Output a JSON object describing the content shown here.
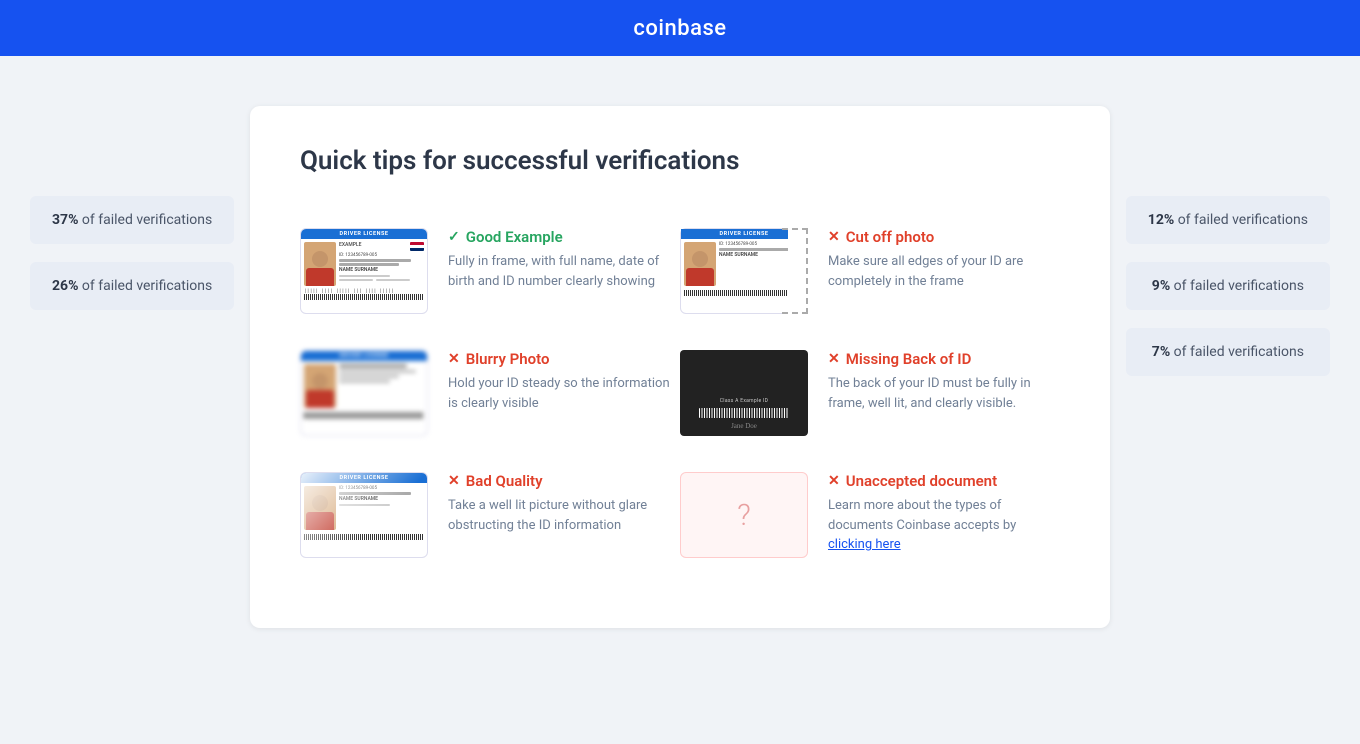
{
  "header": {
    "logo": "coinbase"
  },
  "page": {
    "title": "Quick tips for successful verifications"
  },
  "side_badges_left": [
    {
      "percent": "37%",
      "label": "of failed verifications"
    },
    {
      "percent": "26%",
      "label": "of failed verifications"
    }
  ],
  "side_badges_right": [
    {
      "percent": "12%",
      "label": "of failed verifications"
    },
    {
      "percent": "9%",
      "label": "of failed verifications"
    },
    {
      "percent": "7%",
      "label": "of failed verifications"
    }
  ],
  "tips": [
    {
      "id": "good-example",
      "type": "good",
      "title": "Good Example",
      "desc": "Fully in frame, with full name, date of birth and ID number clearly showing",
      "link": null
    },
    {
      "id": "cut-off-photo",
      "type": "bad",
      "title": "Cut off photo",
      "desc": "Make sure all edges of your ID are completely in the frame",
      "link": null
    },
    {
      "id": "blurry-photo",
      "type": "bad",
      "title": "Blurry Photo",
      "desc": "Hold your ID steady so the information is clearly visible",
      "link": null
    },
    {
      "id": "missing-back-of-id",
      "type": "bad",
      "title": "Missing Back of ID",
      "desc": "The back of your ID must be fully in frame, well lit, and clearly visible.",
      "link": null
    },
    {
      "id": "bad-quality",
      "type": "bad",
      "title": "Bad Quality",
      "desc": "Take a well lit picture without glare obstructing the ID information",
      "link": null
    },
    {
      "id": "unaccepted-document",
      "type": "bad",
      "title": "Unaccepted document",
      "desc": "Learn more about the types of documents Coinbase accepts by ",
      "link_text": "clicking here",
      "link": "#"
    }
  ],
  "id_card_labels": {
    "driver_license": "DRIVER LICENSE",
    "example": "EXAMPLE",
    "id_number": "ID: 123456789-005",
    "name": "NAME SURNAME",
    "class_a": "Class A Example ID"
  }
}
